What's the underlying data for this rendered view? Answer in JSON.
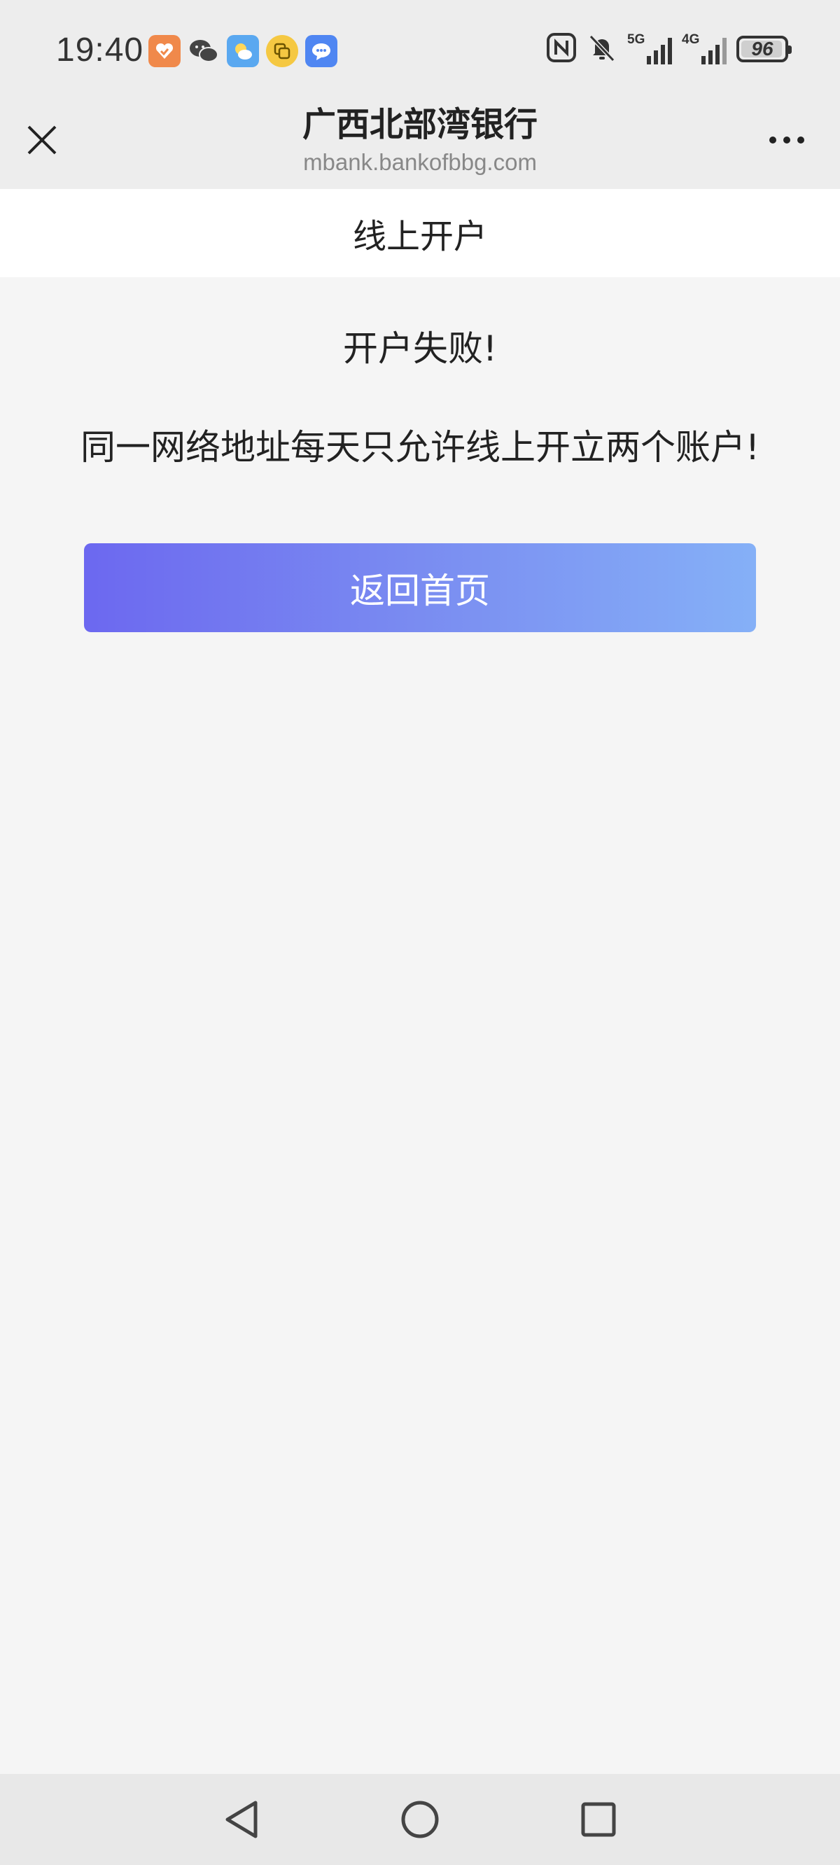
{
  "status_bar": {
    "time": "19:40",
    "notifications": [
      "health-app-icon",
      "wechat-icon",
      "weather-icon",
      "clone-app-icon",
      "messages-icon"
    ],
    "signal_1_label": "5G",
    "signal_2_label": "4G",
    "battery_level": "96",
    "battery_fraction": 0.96
  },
  "header": {
    "title": "广西北部湾银行",
    "url": "mbank.bankofbbg.com"
  },
  "page": {
    "title": "线上开户"
  },
  "result": {
    "title": "开户失败!",
    "message": "同一网络地址每天只允许线上开立两个账户!",
    "button_label": "返回首页"
  },
  "colors": {
    "button_gradient_start": "#6c68f0",
    "button_gradient_end": "#85b0f7",
    "background": "#f5f5f5",
    "header_bg": "#ededed"
  }
}
